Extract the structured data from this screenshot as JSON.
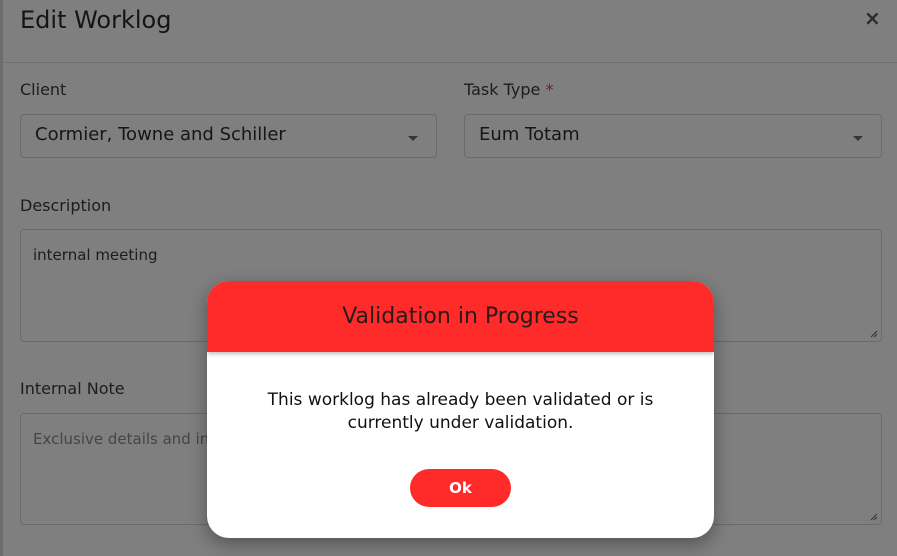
{
  "form": {
    "title": "Edit Worklog",
    "close_glyph": "×",
    "client": {
      "label": "Client",
      "value": "Cormier, Towne and Schiller"
    },
    "task_type": {
      "label": "Task Type",
      "required_mark": "*",
      "value": "Eum Totam"
    },
    "description": {
      "label": "Description",
      "value": "internal meeting"
    },
    "internal_note": {
      "label": "Internal Note",
      "placeholder": "Exclusive details and in"
    }
  },
  "modal": {
    "title": "Validation in Progress",
    "message_line1": "This worklog has already been validated or is",
    "message_line2": "currently under validation.",
    "ok_label": "Ok"
  },
  "colors": {
    "accent": "#ff2a2a"
  }
}
